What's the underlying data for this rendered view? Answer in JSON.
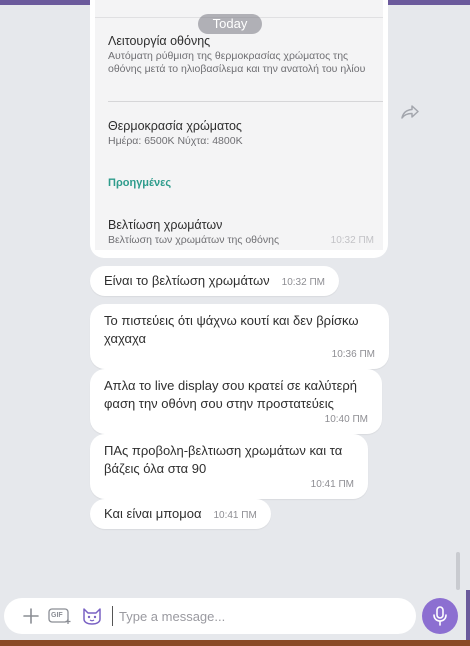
{
  "chat": {
    "date_separator": "Today",
    "image_message": {
      "time": "10:32 ΠΜ",
      "settings": [
        {
          "title": "Λειτουργία οθόνης",
          "subtitle": "Αυτόματη ρύθμιση της θερμοκρασίας χρώματος της οθόνης μετά το ηλιοβασίλεμα και την ανατολή του ηλίου"
        },
        {
          "title": "Θερμοκρασία χρώματος",
          "subtitle": "Ημέρα: 6500K Νύχτα: 4800K"
        },
        {
          "section": "Προηγμένες"
        },
        {
          "title": "Βελτίωση χρωμάτων",
          "subtitle": "Βελτίωση των χρωμάτων της οθόνης"
        }
      ]
    },
    "messages": [
      {
        "text": "Είναι το βελτίωση χρωμάτων",
        "time": "10:32 ΠΜ"
      },
      {
        "text": "Το πιστεύεις ότι ψάχνω κουτί και δεν βρίσκω χαχαχα",
        "time": "10:36 ΠΜ"
      },
      {
        "text": "Απλα το live display σου κρατεί σε καλύτερή φαση την οθόνη σου στην προστατεύεις",
        "time": "10:40 ΠΜ"
      },
      {
        "text": "ΠΑς προβολη-βελτιωση χρωμάτων και τα βάζεις όλα στα 90",
        "time": "10:41 ΠΜ"
      },
      {
        "text": "Και είναι μπομοα",
        "time": "10:41 ΠΜ"
      }
    ]
  },
  "composer": {
    "placeholder": "Type a message...",
    "icons": [
      "plus-icon",
      "gif-icon",
      "sticker-cat-icon",
      "microphone-icon"
    ],
    "gif_label": "GIF"
  },
  "colors": {
    "background": "#e6e8ec",
    "bubble": "#ffffff",
    "accent_purple": "#8c6fd1",
    "settings_accent": "#2e9c8c"
  }
}
